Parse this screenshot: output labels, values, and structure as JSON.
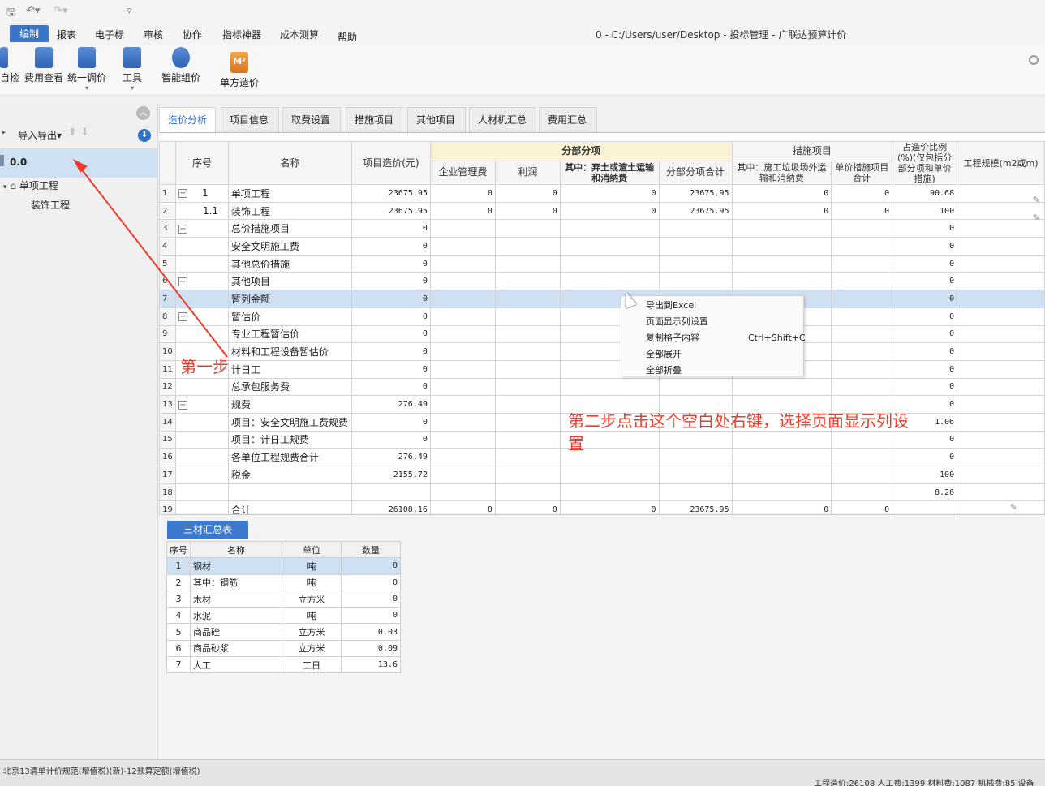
{
  "quick_access": {
    "save": "🖫",
    "undo": "↶▾",
    "redo": "↷▾",
    "more": "▿"
  },
  "menu": {
    "items": [
      "编制",
      "报表",
      "电子标",
      "审核",
      "协作",
      "指标神器",
      "成本测算",
      "帮助"
    ],
    "active": "编制"
  },
  "window_title": "0 - C:/Users/user/Desktop - 投标管理 - 广联达预算计价",
  "ribbon": {
    "buttons": [
      {
        "label": "自检"
      },
      {
        "label": "费用查看"
      },
      {
        "label": "统一调价"
      },
      {
        "label": "工具"
      },
      {
        "label": "智能组价"
      },
      {
        "label": "单方造价",
        "badge": "M²"
      }
    ]
  },
  "left_panel": {
    "import_export": "导入导出",
    "tree_root": "0.0",
    "tree": [
      {
        "label": "单项工程"
      },
      {
        "label": "装饰工程"
      }
    ]
  },
  "tabs": [
    "造价分析",
    "项目信息",
    "取费设置",
    "措施项目",
    "其他项目",
    "人材机汇总",
    "费用汇总"
  ],
  "active_tab": "造价分析",
  "grid": {
    "headers": {
      "seq": "序号",
      "name": "名称",
      "project_cost": "项目造价(元)",
      "group_fbfx": "分部分项",
      "mgmt_fee": "企业管理费",
      "profit": "利润",
      "waste_fee": "其中：弃土或渣土运输和消纳费",
      "fbfx_total": "分部分项合计",
      "group_measures": "措施项目",
      "garbage_fee": "其中：施工垃圾场外运输和消纳费",
      "unit_measure_total": "单价措施项目合计",
      "ratio": "占造价比例(%)(仅包括分部分项和单价措施)",
      "scale": "工程规模(m2或m)"
    },
    "rows": [
      {
        "idx": "1",
        "toggle": "−",
        "seq": "1",
        "name": "单项工程",
        "cost": "23675.95",
        "mgmt": "0",
        "profit": "0",
        "waste": "0",
        "total": "23675.95",
        "garbage": "0",
        "unit_total": "0",
        "ratio": "90.68"
      },
      {
        "idx": "2",
        "toggle": "",
        "seq": "1.1",
        "name": "装饰工程",
        "cost": "23675.95",
        "mgmt": "0",
        "profit": "0",
        "waste": "0",
        "total": "23675.95",
        "garbage": "0",
        "unit_total": "0",
        "ratio": "100"
      },
      {
        "idx": "3",
        "toggle": "−",
        "seq": "",
        "name": "总价措施项目",
        "cost": "0",
        "ratio": "0"
      },
      {
        "idx": "4",
        "toggle": "",
        "seq": "",
        "name": "安全文明施工费",
        "cost": "0",
        "ratio": "0"
      },
      {
        "idx": "5",
        "toggle": "",
        "seq": "",
        "name": "其他总价措施",
        "cost": "0",
        "ratio": "0"
      },
      {
        "idx": "6",
        "toggle": "−",
        "seq": "",
        "name": "其他项目",
        "cost": "0",
        "ratio": "0"
      },
      {
        "idx": "7",
        "toggle": "",
        "seq": "",
        "name": "暂列金额",
        "cost": "0",
        "ratio": "0"
      },
      {
        "idx": "8",
        "toggle": "−",
        "seq": "",
        "name": "暂估价",
        "cost": "0",
        "ratio": "0"
      },
      {
        "idx": "9",
        "toggle": "",
        "seq": "",
        "name": "专业工程暂估价",
        "cost": "0",
        "ratio": "0"
      },
      {
        "idx": "10",
        "toggle": "",
        "seq": "",
        "name": "材料和工程设备暂估价",
        "cost": "0",
        "ratio": "0"
      },
      {
        "idx": "11",
        "toggle": "",
        "seq": "",
        "name": "计日工",
        "cost": "0",
        "ratio": "0"
      },
      {
        "idx": "12",
        "toggle": "",
        "seq": "",
        "name": "总承包服务费",
        "cost": "0",
        "ratio": "0"
      },
      {
        "idx": "13",
        "toggle": "−",
        "seq": "",
        "name": "规费",
        "cost": "276.49",
        "ratio": "0"
      },
      {
        "idx": "14",
        "toggle": "",
        "seq": "",
        "name": "项目：安全文明施工费规费",
        "cost": "0",
        "ratio": "1.06"
      },
      {
        "idx": "15",
        "toggle": "",
        "seq": "",
        "name": "项目：计日工规费",
        "cost": "0",
        "ratio": "0"
      },
      {
        "idx": "16",
        "toggle": "",
        "seq": "",
        "name": "各单位工程规费合计",
        "cost": "276.49",
        "ratio": "0"
      },
      {
        "idx": "17",
        "toggle": "",
        "seq": "",
        "name": "税金",
        "cost": "2155.72",
        "ratio": "100"
      },
      {
        "idx": "18",
        "toggle": "",
        "seq": "",
        "name": "",
        "cost": "",
        "ratio": "8.26"
      },
      {
        "idx": "19",
        "toggle": "",
        "seq": "",
        "name": "合计",
        "cost": "26108.16",
        "mgmt": "0",
        "profit": "0",
        "waste": "0",
        "total": "23675.95",
        "garbage": "0",
        "unit_total": "0",
        "ratio": ""
      }
    ]
  },
  "context_menu": {
    "items": [
      {
        "label": "导出到Excel",
        "shortcut": ""
      },
      {
        "label": "页面显示列设置",
        "shortcut": ""
      },
      {
        "label": "复制格子内容",
        "shortcut": "Ctrl+Shift+C"
      },
      {
        "label": "全部展开",
        "shortcut": ""
      },
      {
        "label": "全部折叠",
        "shortcut": ""
      }
    ]
  },
  "materials": {
    "tab": "三材汇总表",
    "headers": [
      "序号",
      "名称",
      "单位",
      "数量"
    ],
    "rows": [
      {
        "idx": "1",
        "name": "钢材",
        "unit": "吨",
        "qty": "0"
      },
      {
        "idx": "2",
        "name": "其中：钢筋",
        "unit": "吨",
        "qty": "0"
      },
      {
        "idx": "3",
        "name": "木材",
        "unit": "立方米",
        "qty": "0"
      },
      {
        "idx": "4",
        "name": "水泥",
        "unit": "吨",
        "qty": "0"
      },
      {
        "idx": "5",
        "name": "商品砼",
        "unit": "立方米",
        "qty": "0.03"
      },
      {
        "idx": "6",
        "name": "商品砂浆",
        "unit": "立方米",
        "qty": "0.09"
      },
      {
        "idx": "7",
        "name": "人工",
        "unit": "工日",
        "qty": "13.6"
      }
    ]
  },
  "status": {
    "left": "北京13清单计价规范(增值税)(新)-12预算定额(增值税)",
    "right": "工程造价:26108   人工费:1399   材料费:1087   机械费:85   设备"
  },
  "annotations": {
    "step1": "第一步",
    "step2": "第二步点击这个空白处右键，选择页面显示列设置"
  },
  "colors": {
    "accent": "#3b75c7",
    "selection": "#cfe0f2",
    "annotation": "#f03b2a"
  }
}
